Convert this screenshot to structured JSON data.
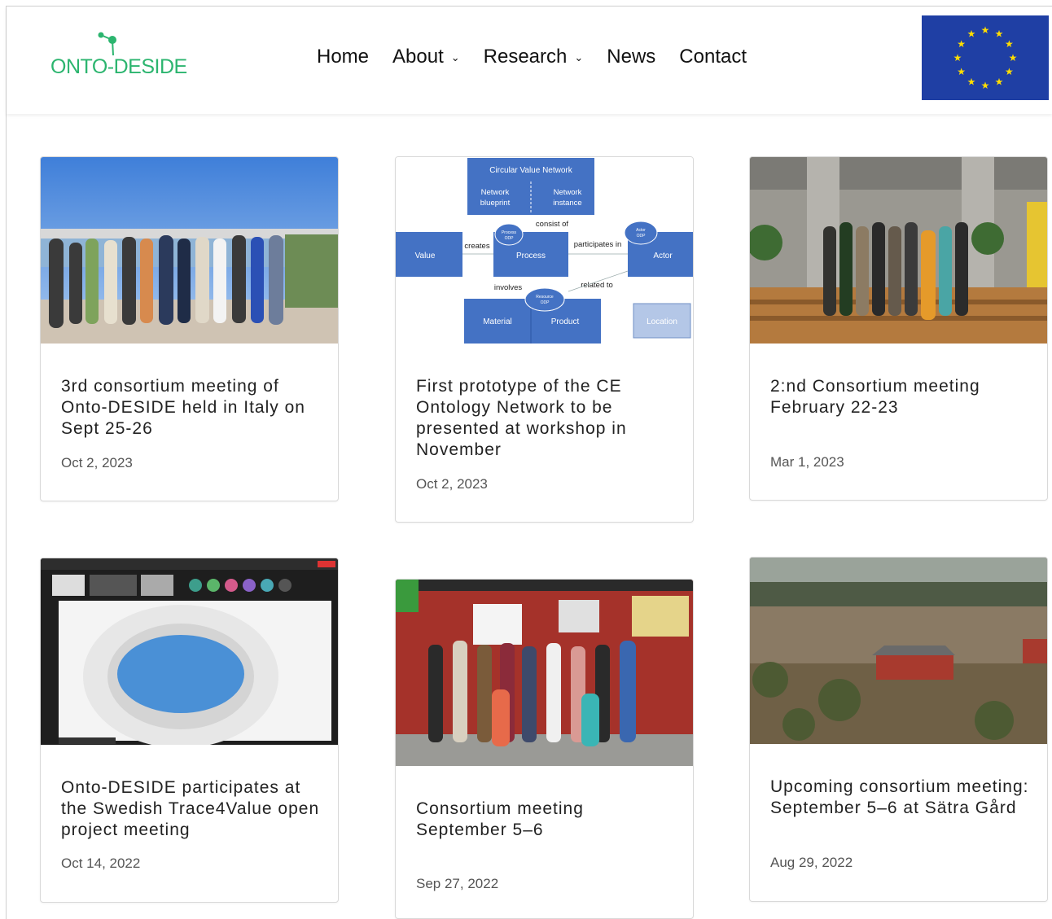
{
  "logo": {
    "text": "ONTO-DESIDE"
  },
  "nav": {
    "items": [
      {
        "label": "Home",
        "has_dropdown": false
      },
      {
        "label": "About",
        "has_dropdown": true
      },
      {
        "label": "Research",
        "has_dropdown": true
      },
      {
        "label": "News",
        "has_dropdown": false
      },
      {
        "label": "Contact",
        "has_dropdown": false
      }
    ]
  },
  "colors": {
    "brand_green": "#2cb56f",
    "eu_blue": "#1f3fa4",
    "eu_star": "#ffdd00",
    "diagram_blue": "#4472c4"
  },
  "diagram": {
    "top_box": "Circular Value Network",
    "network_blueprint": "Network blueprint",
    "network_instance": "Network instance",
    "consist_of": "consist of",
    "value": "Value",
    "creates": "creates",
    "process": "Process",
    "process_odp": "Process ODP",
    "participates_in": "participates in",
    "actor": "Actor",
    "actor_odp": "Actor ODP",
    "involves": "involves",
    "related_to": "related to",
    "resource_odp": "Resource ODP",
    "material": "Material",
    "product": "Product",
    "location": "Location"
  },
  "posts": [
    {
      "title": "3rd consortium meeting of Onto-DESIDE held in Italy on Sept 25-26",
      "date": "Oct 2, 2023",
      "image": "group-photo-terrace"
    },
    {
      "title": "First prototype of the CE Ontology Network to be presented at workshop in November",
      "date": "Oct 2, 2023",
      "image": "ontology-diagram"
    },
    {
      "title": "2:nd Consortium meeting February 22-23",
      "date": "Mar 1, 2023",
      "image": "group-photo-office"
    },
    {
      "title": "Onto-DESIDE participates at the Swedish Trace4Value open project meeting",
      "date": "Oct 14, 2022",
      "image": "video-call-screenshot"
    },
    {
      "title": "Consortium meeting September 5–6",
      "date": "Sep 27, 2022",
      "image": "group-photo-red-house"
    },
    {
      "title": "Upcoming consortium meeting: September 5–6 at Sätra Gård",
      "date": "Aug 29, 2022",
      "image": "aerial-farm-photo"
    }
  ]
}
